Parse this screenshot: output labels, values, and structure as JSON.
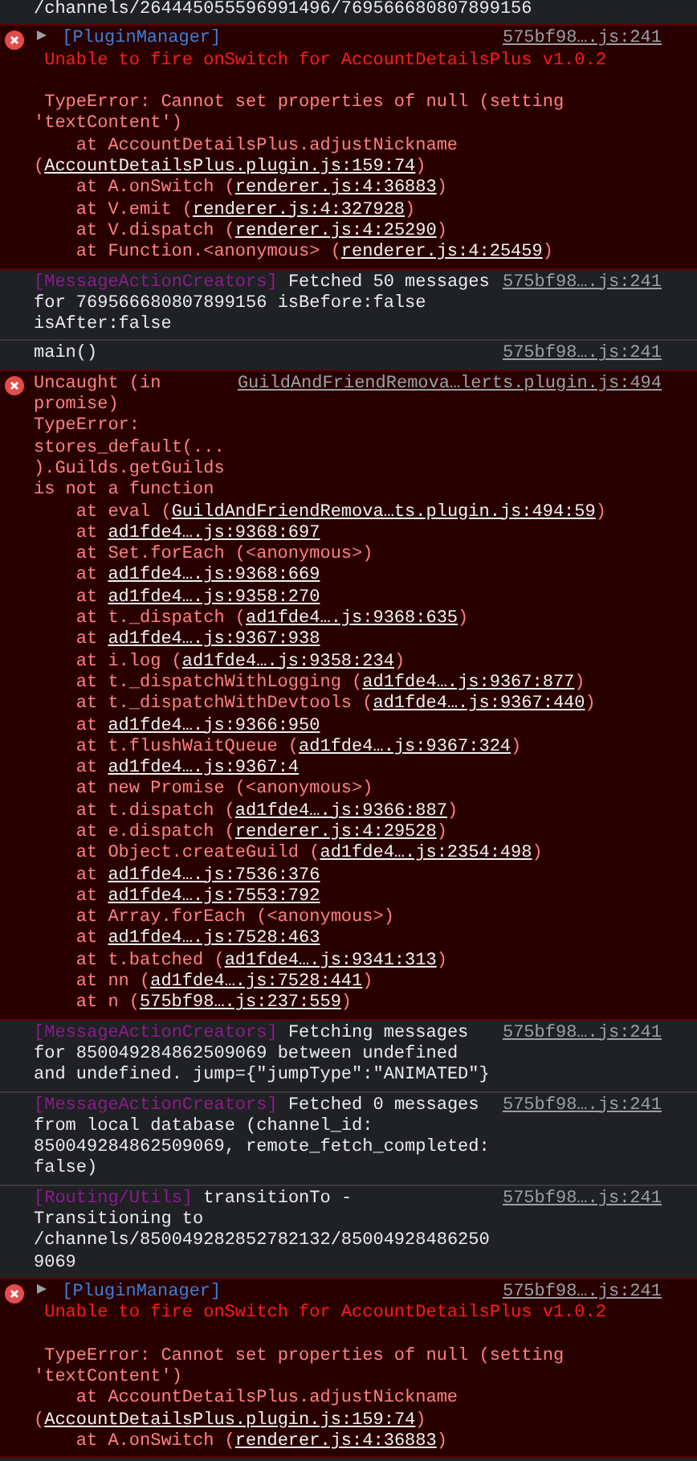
{
  "console": {
    "entries": [
      {
        "kind": "log",
        "text": "/channels/264445055596991496/769566680807899156"
      },
      {
        "kind": "error",
        "expanded": false,
        "tag": {
          "text": "[PluginManager]",
          "color": "#3d7fd8"
        },
        "source": "575bf98….js:241",
        "lines": [
          {
            "kind": "message",
            "text": "Unable to fire onSwitch for AccountDetailsPlus v1.0.2"
          },
          {
            "kind": "exception",
            "text": "TypeError: Cannot set properties of null (setting 'textContent')"
          }
        ],
        "stack": [
          {
            "text": "at AccountDetailsPlus.adjustNickname (",
            "link": "AccountDetailsPlus.plugin.js:159:74",
            "end": ")"
          },
          {
            "text": "at A.onSwitch (",
            "link": "renderer.js:4:36883",
            "end": ")"
          },
          {
            "text": "at V.emit (",
            "link": "renderer.js:4:327928",
            "end": ")"
          },
          {
            "text": "at V.dispatch (",
            "link": "renderer.js:4:25290",
            "end": ")"
          },
          {
            "text": "at Function.<anonymous> (",
            "link": "renderer.js:4:25459",
            "end": ")"
          }
        ]
      },
      {
        "kind": "log",
        "tag": {
          "text": "[MessageActionCreators]",
          "color": "#8a1c8a"
        },
        "text": "Fetched 50 messages for 769566680807899156 isBefore:false isAfter:false",
        "source": "575bf98….js:241"
      },
      {
        "kind": "log",
        "text": "main()",
        "source": "575bf98….js:241"
      },
      {
        "kind": "error",
        "text": "Uncaught (in promise) TypeError: stores_default(...).Guilds.getGuilds is not a function",
        "source": "GuildAndFriendRemova…lerts.plugin.js:494",
        "stack": [
          {
            "text": "at eval (",
            "link": "GuildAndFriendRemova…ts.plugin.js:494:59",
            "end": ")"
          },
          {
            "text": "at ",
            "link": "ad1fde4….js:9368:697"
          },
          {
            "text": "at Set.forEach (<anonymous>)"
          },
          {
            "text": "at ",
            "link": "ad1fde4….js:9368:669"
          },
          {
            "text": "at ",
            "link": "ad1fde4….js:9358:270"
          },
          {
            "text": "at t._dispatch (",
            "link": "ad1fde4….js:9368:635",
            "end": ")"
          },
          {
            "text": "at ",
            "link": "ad1fde4….js:9367:938"
          },
          {
            "text": "at i.log (",
            "link": "ad1fde4….js:9358:234",
            "end": ")"
          },
          {
            "text": "at t._dispatchWithLogging (",
            "link": "ad1fde4….js:9367:877",
            "end": ")"
          },
          {
            "text": "at t._dispatchWithDevtools (",
            "link": "ad1fde4….js:9367:440",
            "end": ")"
          },
          {
            "text": "at ",
            "link": "ad1fde4….js:9366:950"
          },
          {
            "text": "at t.flushWaitQueue (",
            "link": "ad1fde4….js:9367:324",
            "end": ")"
          },
          {
            "text": "at ",
            "link": "ad1fde4….js:9367:4"
          },
          {
            "text": "at new Promise (<anonymous>)"
          },
          {
            "text": "at t.dispatch (",
            "link": "ad1fde4….js:9366:887",
            "end": ")"
          },
          {
            "text": "at e.dispatch (",
            "link": "renderer.js:4:29528",
            "end": ")"
          },
          {
            "text": "at Object.createGuild (",
            "link": "ad1fde4….js:2354:498",
            "end": ")"
          },
          {
            "text": "at ",
            "link": "ad1fde4….js:7536:376"
          },
          {
            "text": "at ",
            "link": "ad1fde4….js:7553:792"
          },
          {
            "text": "at Array.forEach (<anonymous>)"
          },
          {
            "text": "at ",
            "link": "ad1fde4….js:7528:463"
          },
          {
            "text": "at t.batched (",
            "link": "ad1fde4….js:9341:313",
            "end": ")"
          },
          {
            "text": "at nn (",
            "link": "ad1fde4….js:7528:441",
            "end": ")"
          },
          {
            "text": "at n (",
            "link": "575bf98….js:237:559",
            "end": ")"
          }
        ]
      },
      {
        "kind": "log",
        "tag": {
          "text": "[MessageActionCreators]",
          "color": "#8a1c8a"
        },
        "text": "Fetching messages for 850049284862509069 between undefined and undefined. jump={\"jumpType\":\"ANIMATED\"}",
        "source": "575bf98….js:241"
      },
      {
        "kind": "log",
        "tag": {
          "text": "[MessageActionCreators]",
          "color": "#8a1c8a"
        },
        "text": "Fetched 0 messages from local database (channel_id: 850049284862509069, remote_fetch_completed: false)",
        "source": "575bf98….js:241"
      },
      {
        "kind": "log",
        "tag": {
          "text": "[Routing/Utils]",
          "color": "#8a1c8a"
        },
        "text": "transitionTo - Transitioning to /channels/850049282852782132/850049284862509069",
        "source": "575bf98….js:241"
      },
      {
        "kind": "error",
        "expanded": false,
        "tag": {
          "text": "[PluginManager]",
          "color": "#3d7fd8"
        },
        "source": "575bf98….js:241",
        "lines": [
          {
            "kind": "message",
            "text": "Unable to fire onSwitch for AccountDetailsPlus v1.0.2"
          },
          {
            "kind": "exception",
            "text": "TypeError: Cannot set properties of null (setting 'textContent')"
          }
        ],
        "stack": [
          {
            "text": "at AccountDetailsPlus.adjustNickname (",
            "link": "AccountDetailsPlus.plugin.js:159:74",
            "end": ")"
          },
          {
            "text": "at A.onSwitch (",
            "link": "renderer.js:4:36883",
            "end": ")"
          }
        ]
      }
    ]
  }
}
